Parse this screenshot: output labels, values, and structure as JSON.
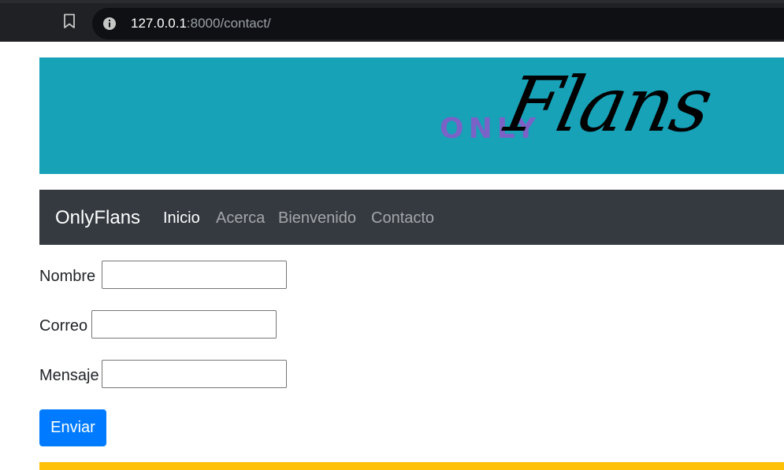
{
  "browser": {
    "url_host": "127.0.0.1",
    "url_rest": ":8000/contact/"
  },
  "banner": {
    "logo_small": "ONLY",
    "logo_big": "Flans",
    "background": "#17a2b8"
  },
  "navbar": {
    "brand": "OnlyFlans",
    "items": [
      {
        "label": "Inicio",
        "active": true
      },
      {
        "label": "Acerca",
        "active": false
      },
      {
        "label": "Bienvenido",
        "active": false
      },
      {
        "label": "Contacto",
        "active": false
      }
    ],
    "background": "#343a40"
  },
  "form": {
    "name_label": "Nombre",
    "email_label": "Correo",
    "message_label": "Mensaje",
    "name_value": "",
    "email_value": "",
    "message_value": "",
    "submit_label": "Enviar"
  },
  "colors": {
    "primary": "#007bff",
    "footer": "#ffc107"
  }
}
